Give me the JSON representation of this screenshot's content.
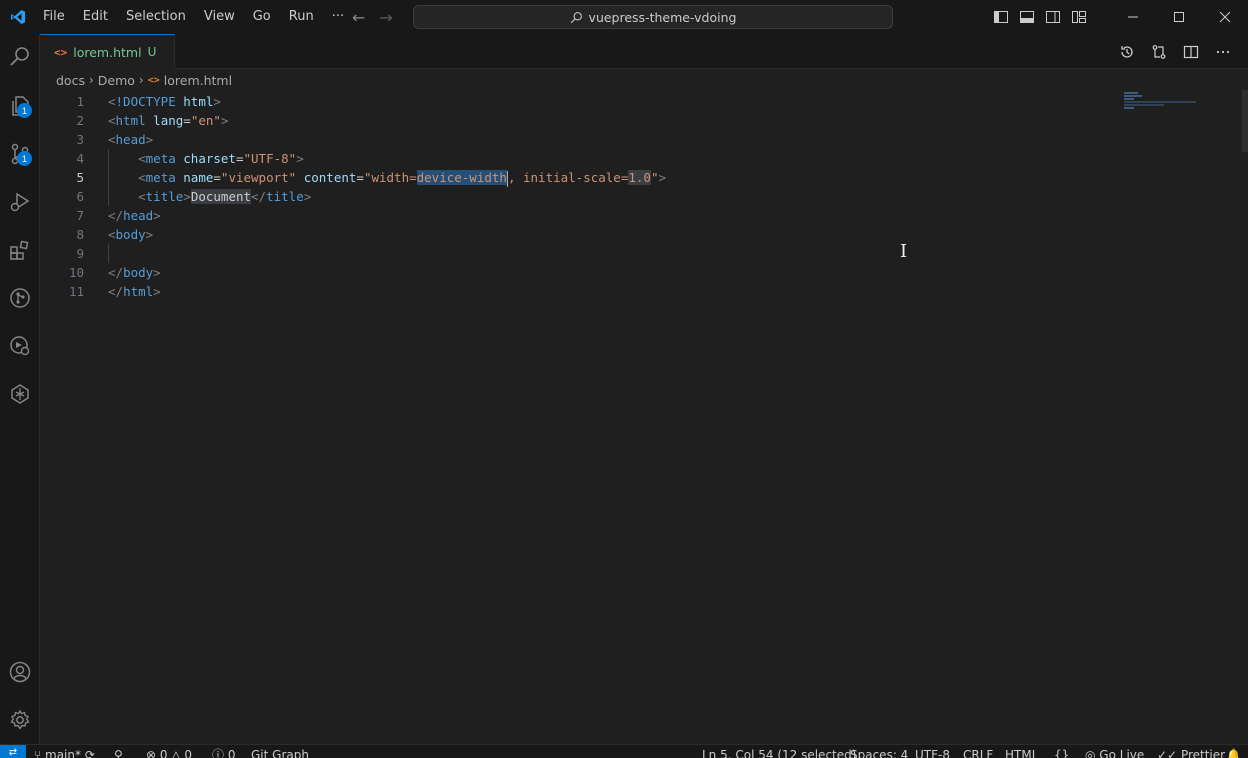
{
  "titlebar": {
    "menu": [
      "File",
      "Edit",
      "Selection",
      "View",
      "Go",
      "Run",
      "···"
    ],
    "search_text": "vuepress-theme-vdoing"
  },
  "activity": {
    "explorer_badge": "1",
    "scm_badge": "1"
  },
  "tab": {
    "label": "lorem.html",
    "status": "U"
  },
  "breadcrumb": [
    "docs",
    "Demo",
    "lorem.html"
  ],
  "editor": {
    "line_numbers": [
      "1",
      "2",
      "3",
      "4",
      "5",
      "6",
      "7",
      "8",
      "9",
      "10",
      "11"
    ],
    "active_line": 5
  },
  "statusbar": {
    "branch": "main*",
    "errors": "0",
    "warnings": "0",
    "info": "0",
    "git_graph": "Git Graph",
    "position": "Ln 5, Col 54 (12 selected)",
    "spaces": "Spaces: 4",
    "encoding": "UTF-8",
    "eol": "CRLF",
    "language": "HTML",
    "go_live": "Go Live",
    "prettier": "Prettier"
  },
  "colors": {
    "accent": "#0078d4",
    "background": "#1f1f1f",
    "tag": "#569cd6",
    "attribute": "#9cdcfe",
    "string": "#ce9178",
    "untracked": "#73c991"
  }
}
